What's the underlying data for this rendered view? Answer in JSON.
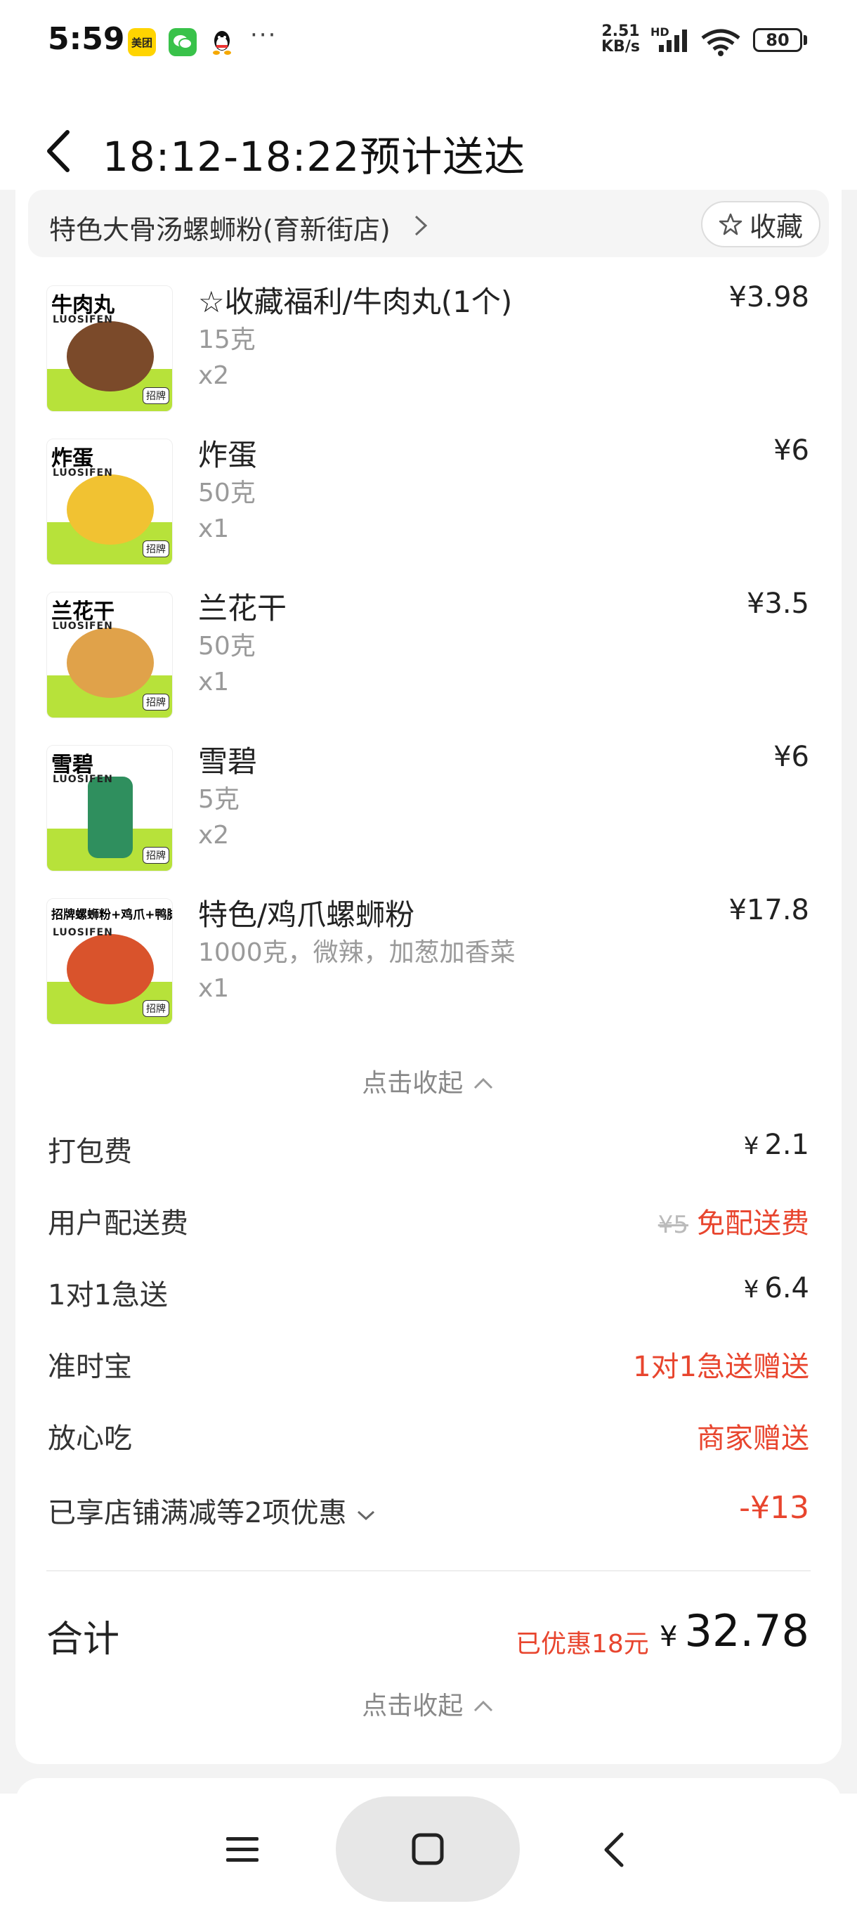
{
  "status_bar": {
    "time": "5:59",
    "apps": [
      "美团",
      "wechat-icon",
      "qq-icon"
    ],
    "more": "···",
    "net_speed_value": "2.51",
    "net_speed_unit": "KB/s",
    "hd": "HD",
    "battery": "80"
  },
  "header": {
    "title": "18:12-18:22预计送达"
  },
  "store": {
    "name": "特色大骨汤螺蛳粉(育新街店)",
    "favorite_label": "收藏"
  },
  "items": [
    {
      "name": "☆收藏福利/牛肉丸(1个)",
      "spec": "15克",
      "qty": "x2",
      "price": "¥3.98",
      "thumb_title": "牛肉丸",
      "thumb_sub": "LUOSIFEN",
      "thumb_badge": "招牌",
      "thumb_color": "#7b4a2a"
    },
    {
      "name": "炸蛋",
      "spec": "50克",
      "qty": "x1",
      "price": "¥6",
      "thumb_title": "炸蛋",
      "thumb_sub": "LUOSIFEN",
      "thumb_badge": "招牌",
      "thumb_color": "#f1c232"
    },
    {
      "name": "兰花干",
      "spec": "50克",
      "qty": "x1",
      "price": "¥3.5",
      "thumb_title": "兰花干",
      "thumb_sub": "LUOSIFEN",
      "thumb_badge": "招牌",
      "thumb_color": "#e0a24a"
    },
    {
      "name": "雪碧",
      "spec": "5克",
      "qty": "x2",
      "price": "¥6",
      "thumb_title": "雪碧",
      "thumb_sub": "LUOSIFEN",
      "thumb_badge": "招牌",
      "thumb_color": "#2f8f5e"
    },
    {
      "name": "特色/鸡爪螺蛳粉",
      "spec": "1000克，微辣，加葱加香菜",
      "qty": "x1",
      "price": "¥17.8",
      "thumb_title": "招牌螺蛳粉+鸡爪+鸭脚",
      "thumb_sub": "LUOSIFEN",
      "thumb_badge": "招牌",
      "thumb_color": "#d9532c"
    }
  ],
  "collapse_label": "点击收起",
  "fees": {
    "packing": {
      "label": "打包费",
      "value": "2.1"
    },
    "delivery": {
      "label": "用户配送费",
      "original": "¥5",
      "value": "免配送费"
    },
    "express": {
      "label": "1对1急送",
      "value": "6.4"
    },
    "ontime": {
      "label": "准时宝",
      "value": "1对1急送赠送"
    },
    "safe": {
      "label": "放心吃",
      "value": "商家赠送"
    },
    "discount": {
      "label": "已享店铺满减等2项优惠",
      "value": "-¥13"
    }
  },
  "currency": "¥",
  "total": {
    "label": "合计",
    "saved": "已优惠18元",
    "amount": "32.78"
  },
  "colors": {
    "accent_red": "#e8452e",
    "thumb_band": "#b7e23a"
  }
}
